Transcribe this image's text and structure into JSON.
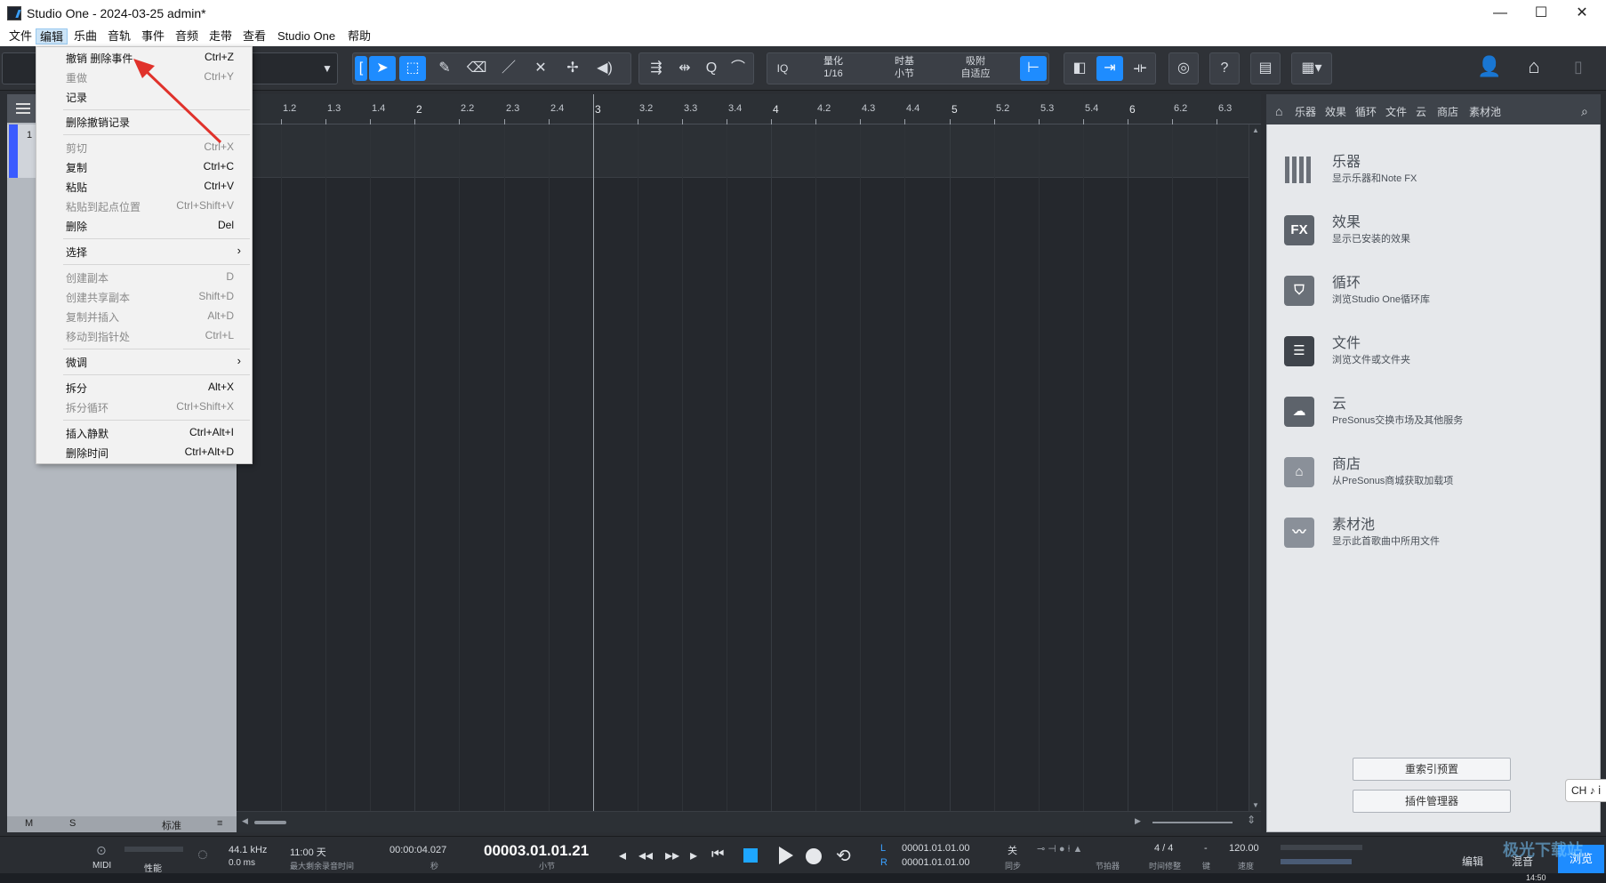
{
  "window": {
    "title": "Studio One - 2024-03-25 admin*",
    "minimize": "—",
    "maximize": "☐",
    "close": "✕"
  },
  "menubar": {
    "items": [
      "文件",
      "编辑",
      "乐曲",
      "音轨",
      "事件",
      "音频",
      "走带",
      "查看",
      "Studio One",
      "帮助"
    ],
    "active": "编辑"
  },
  "toolbar": {
    "quantize_label": "量化",
    "quantize_value": "1/16",
    "timebase_label": "时基",
    "timebase_value": "小节",
    "snap_label": "吸附",
    "snap_value": "自适应",
    "iq": "IQ",
    "help": "?"
  },
  "edit_menu": {
    "items": [
      {
        "label": "撤销 删除事件",
        "shortcut": "Ctrl+Z",
        "enabled": true
      },
      {
        "label": "重做",
        "shortcut": "Ctrl+Y",
        "enabled": false
      },
      {
        "label": "记录",
        "shortcut": "",
        "enabled": true
      },
      {
        "label": "删除撤销记录",
        "shortcut": "",
        "enabled": true
      },
      {
        "label": "剪切",
        "shortcut": "Ctrl+X",
        "enabled": false
      },
      {
        "label": "复制",
        "shortcut": "Ctrl+C",
        "enabled": true
      },
      {
        "label": "粘贴",
        "shortcut": "Ctrl+V",
        "enabled": true
      },
      {
        "label": "粘贴到起点位置",
        "shortcut": "Ctrl+Shift+V",
        "enabled": false
      },
      {
        "label": "删除",
        "shortcut": "Del",
        "enabled": true
      },
      {
        "label": "选择",
        "shortcut": "",
        "enabled": true,
        "submenu": true
      },
      {
        "label": "创建副本",
        "shortcut": "D",
        "enabled": false
      },
      {
        "label": "创建共享副本",
        "shortcut": "Shift+D",
        "enabled": false
      },
      {
        "label": "复制并插入",
        "shortcut": "Alt+D",
        "enabled": false
      },
      {
        "label": "移动到指针处",
        "shortcut": "Ctrl+L",
        "enabled": false
      },
      {
        "label": "微调",
        "shortcut": "",
        "enabled": true,
        "submenu": true
      },
      {
        "label": "拆分",
        "shortcut": "Alt+X",
        "enabled": true
      },
      {
        "label": "拆分循环",
        "shortcut": "Ctrl+Shift+X",
        "enabled": false
      },
      {
        "label": "插入静默",
        "shortcut": "Ctrl+Alt+I",
        "enabled": true
      },
      {
        "label": "删除时间",
        "shortcut": "Ctrl+Alt+D",
        "enabled": true
      }
    ]
  },
  "ruler": {
    "labels": [
      "1.2",
      "1.3",
      "1.4",
      "2",
      "2.2",
      "2.3",
      "2.4",
      "3",
      "3.2",
      "3.3",
      "3.4",
      "4",
      "4.2",
      "4.3",
      "4.4",
      "5",
      "5.2",
      "5.3",
      "5.4",
      "6",
      "6.2",
      "6.3"
    ]
  },
  "tracks": {
    "track_number": "1",
    "footer_m": "M",
    "footer_s": "S",
    "footer_mode": "标准"
  },
  "browser": {
    "tabs": [
      "乐器",
      "效果",
      "循环",
      "文件",
      "云",
      "商店",
      "素材池"
    ],
    "items": [
      {
        "title": "乐器",
        "desc": "显示乐器和Note FX",
        "icon": "instrument-icon"
      },
      {
        "title": "效果",
        "desc": "显示已安装的效果",
        "icon": "fx-icon"
      },
      {
        "title": "循环",
        "desc": "浏览Studio One循环库",
        "icon": "loop-icon"
      },
      {
        "title": "文件",
        "desc": "浏览文件或文件夹",
        "icon": "file-icon"
      },
      {
        "title": "云",
        "desc": "PreSonus交换市场及其他服务",
        "icon": "cloud-icon"
      },
      {
        "title": "商店",
        "desc": "从PreSonus商城获取加载项",
        "icon": "shop-icon"
      },
      {
        "title": "素材池",
        "desc": "显示此首歌曲中所用文件",
        "icon": "pool-icon"
      }
    ],
    "fx_glyph": "FX",
    "rebuild_button": "重索引预置",
    "plugin_manager_button": "插件管理器"
  },
  "transport": {
    "midi": "MIDI",
    "performance": "性能",
    "sample_rate": "44.1 kHz",
    "latency": "0.0 ms",
    "record_time": "11:00 天",
    "record_time_label": "最大剩余录音时间",
    "seconds_value": "00:00:04.027",
    "seconds_label": "秒",
    "bars_value": "00003.01.01.21",
    "bars_label": "小节",
    "loop_l_label": "L",
    "loop_r_label": "R",
    "loop_l": "00001.01.01.00",
    "loop_r": "00001.01.01.00",
    "sync_value": "关",
    "sync_label": "同步",
    "metronome_label": "节拍器",
    "time_sig": "4 / 4",
    "time_sig_label": "时间修整",
    "key_value": "-",
    "key_label": "键",
    "tempo": "120.00",
    "tempo_label": "速度",
    "edit_btn": "编辑",
    "mix_btn": "混音",
    "browse_btn": "浏览",
    "clock": "14:50"
  },
  "ime": {
    "label": "CH ♪ ⅰ"
  },
  "watermark": "极光下载站"
}
